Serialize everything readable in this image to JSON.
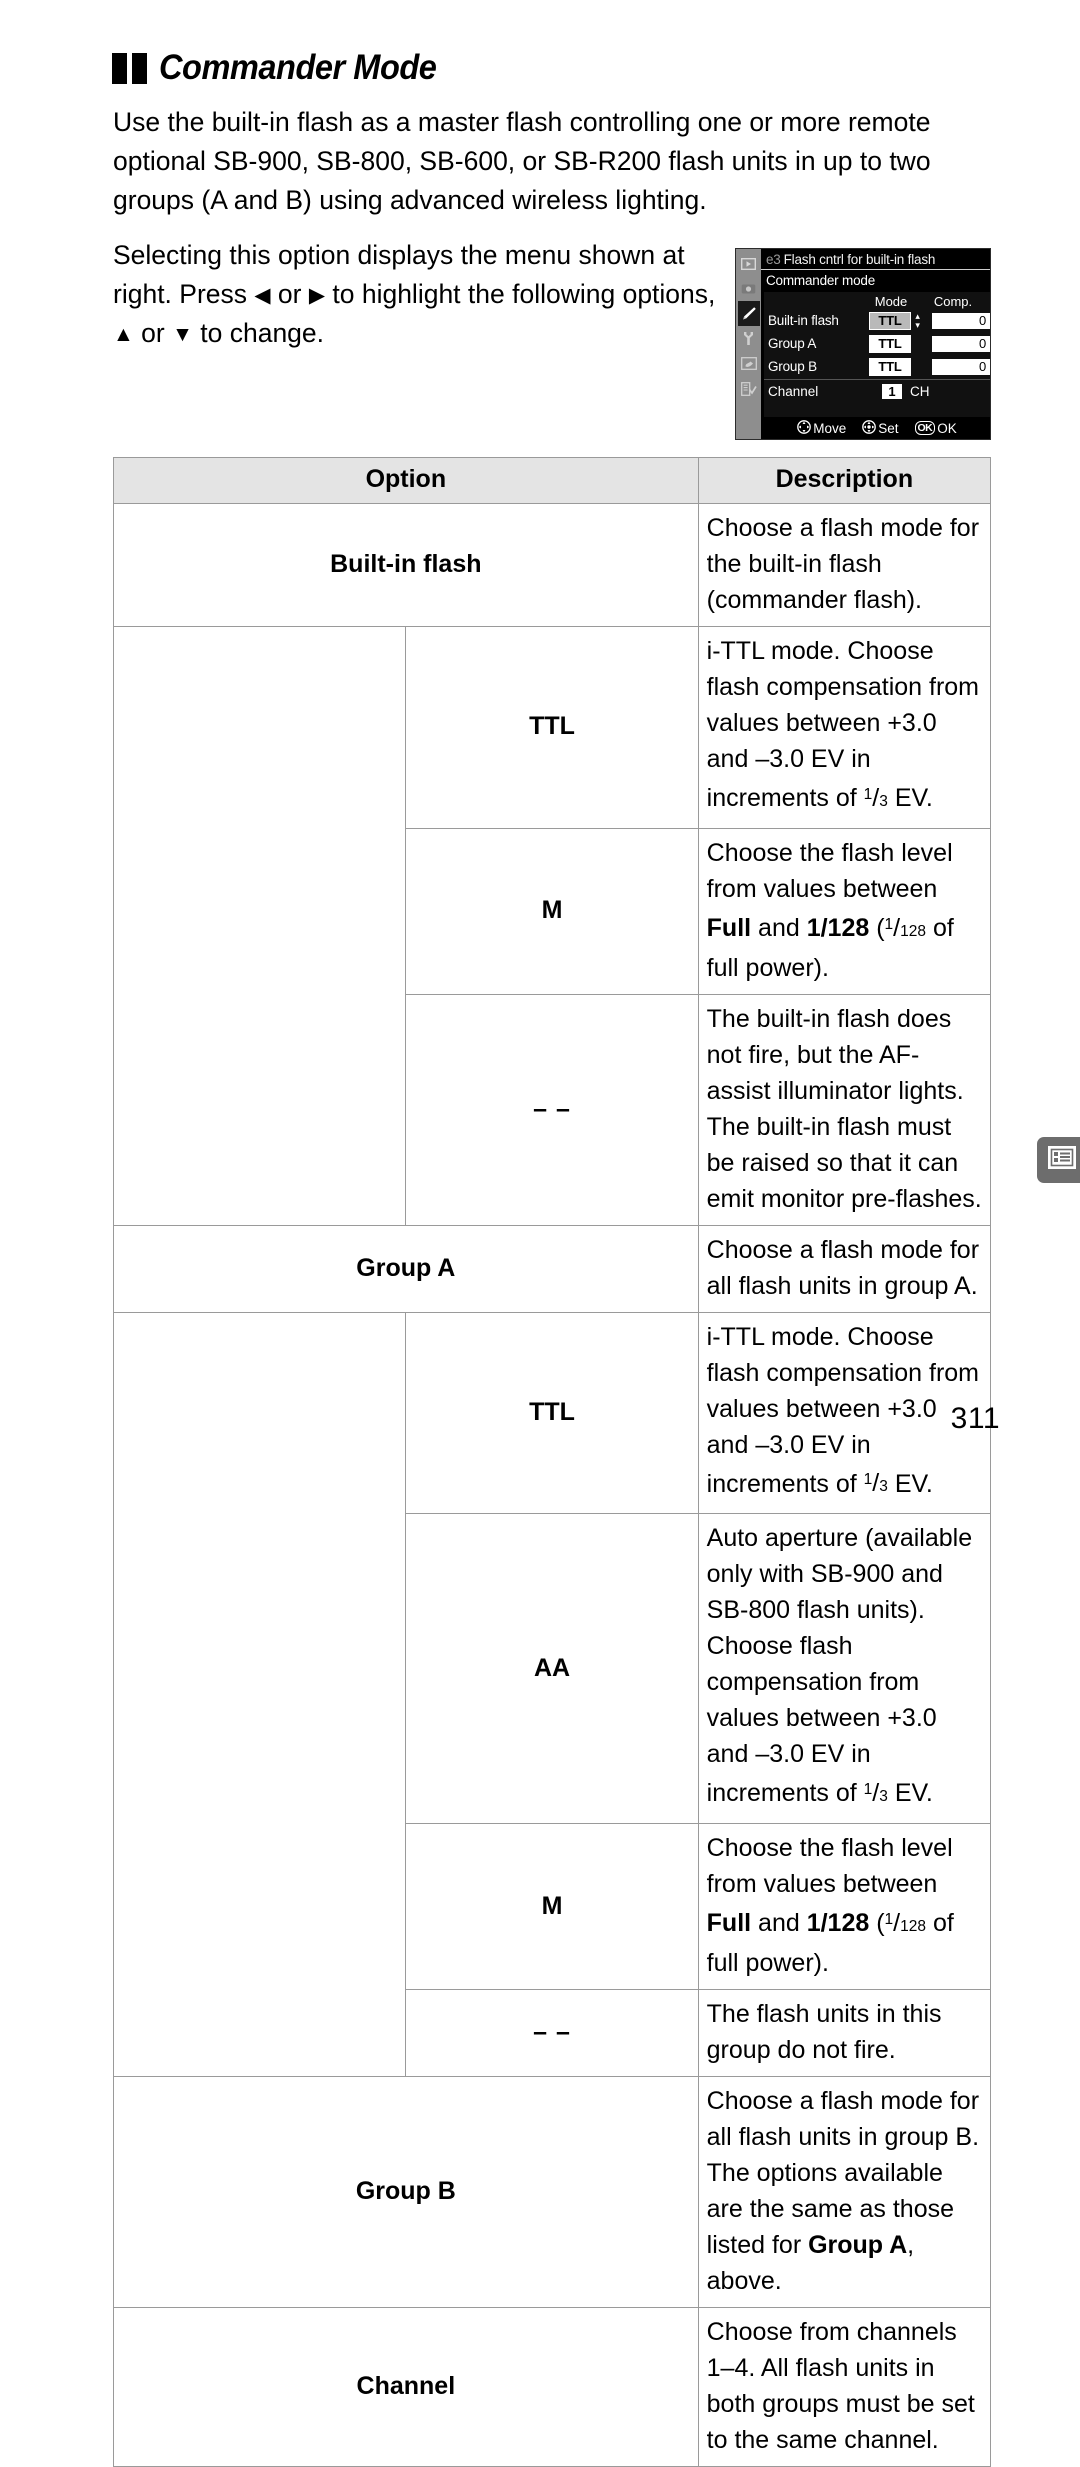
{
  "heading": {
    "title": "Commander Mode",
    "bullet_icon": "double-square-bullet"
  },
  "intro_paragraph": "Use the built-in flash as a master flash controlling one or more remote optional SB-900, SB-800, SB-600, or SB-R200 flash units in up to two groups (A and B) using advanced wireless lighting.",
  "instruction_paragraph": {
    "part1": "Selecting this option displays the menu shown at right.  Press ",
    "left_arrow": "◀",
    "part2": " or ",
    "right_arrow": "▶",
    "part3": " to highlight the following options, ",
    "up_arrow": "▲",
    "part4": " or ",
    "down_arrow": "▼",
    "part5": " to change."
  },
  "lcd": {
    "menu_id": "e3",
    "title": "Flash cntrl for built-in flash",
    "subtitle": "Commander mode",
    "columns": {
      "mode": "Mode",
      "comp": "Comp."
    },
    "rows": [
      {
        "label": "Built-in flash",
        "mode": "TTL",
        "comp": "0",
        "highlighted": true
      },
      {
        "label": "Group A",
        "mode": "TTL",
        "comp": "0",
        "highlighted": false
      },
      {
        "label": "Group B",
        "mode": "TTL",
        "comp": "0",
        "highlighted": false
      }
    ],
    "channel": {
      "label": "Channel",
      "value": "1",
      "unit": "CH"
    },
    "footer": {
      "move": "Move",
      "set": "Set",
      "ok_badge": "OK",
      "ok": "OK"
    },
    "sidebar_icons": [
      "playback-icon",
      "shooting-menu-icon",
      "custom-settings-pencil-icon",
      "setup-wrench-icon",
      "retouch-icon",
      "recent-settings-icon"
    ],
    "colors": {
      "background": "#000000",
      "sidebar": "#8e8e8e",
      "highlight": "#b9b9b9"
    }
  },
  "table": {
    "headers": {
      "option": "Option",
      "description": "Description"
    },
    "rows": [
      {
        "type": "main",
        "option": "Built-in flash",
        "description": "Choose a flash mode for the built-in flash (commander flash)."
      },
      {
        "type": "sub",
        "option": "TTL",
        "description_a": "i-TTL mode.  Choose flash compensation from values between +3.0 and –3.0 EV in increments of ",
        "fraction_num": "1",
        "fraction_den": "3",
        "description_b": " EV."
      },
      {
        "type": "sub",
        "option": "M",
        "description_a": "Choose the flash level from values between ",
        "bold_1": "Full",
        "description_b": " and ",
        "bold_2": "1/128",
        "description_c": " (",
        "fraction_num": "1",
        "fraction_den": "128",
        "description_d": " of full power)."
      },
      {
        "type": "sub",
        "option": "– –",
        "description": "The built-in flash does not fire, but the AF-assist illuminator lights.  The built-in flash must be raised so that it can emit monitor pre-flashes."
      },
      {
        "type": "main",
        "option": "Group A",
        "description": "Choose a flash mode for all flash units in group A."
      },
      {
        "type": "sub",
        "option": "TTL",
        "description_a": "i-TTL mode.  Choose flash compensation from values between +3.0 and –3.0 EV in increments of ",
        "fraction_num": "1",
        "fraction_den": "3",
        "description_b": " EV."
      },
      {
        "type": "sub",
        "option": "AA",
        "description_a": "Auto aperture (available only with SB-900 and SB-800 flash units).  Choose flash compensation from values between +3.0 and –3.0 EV in increments of ",
        "fraction_num": "1",
        "fraction_den": "3",
        "description_b": " EV."
      },
      {
        "type": "sub",
        "option": "M",
        "description_a": "Choose the flash level from values between ",
        "bold_1": "Full",
        "description_b": " and ",
        "bold_2": "1/128",
        "description_c": " (",
        "fraction_num": "1",
        "fraction_den": "128",
        "description_d": " of full power)."
      },
      {
        "type": "sub",
        "option": "– –",
        "description": "The flash units in this group do not fire."
      },
      {
        "type": "main",
        "option": "Group B",
        "description_a": "Choose a flash mode for all flash units in group B.  The options available are the same as those listed for ",
        "bold_1": "Group A",
        "description_b": ", above."
      },
      {
        "type": "main",
        "option": "Channel",
        "description": "Choose from channels 1–4.  All flash units in both groups must be set to the same channel."
      }
    ],
    "header_background": "#e4e4e4",
    "border_color": "#9a9a9a"
  },
  "side_tab": {
    "icon": "menu-list-icon",
    "color": "#6d6d6d"
  },
  "page_number": "311"
}
